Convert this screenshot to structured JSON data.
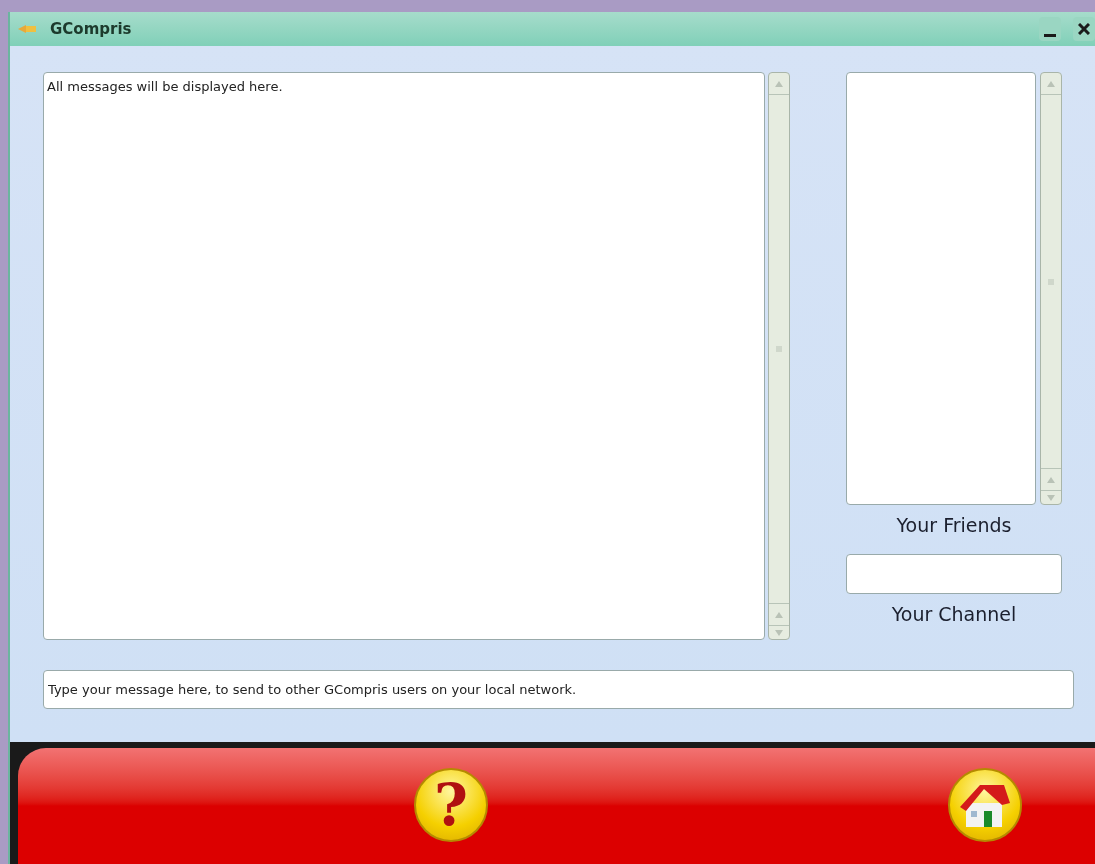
{
  "window": {
    "title": "GCompris"
  },
  "messages": {
    "value": "All messages will be displayed here."
  },
  "friends": {
    "label": "Your Friends"
  },
  "channel": {
    "label": "Your Channel"
  },
  "message_input": {
    "value": "Type your message here, to send to other GCompris users on your local network."
  },
  "help_button": {
    "label": "?"
  }
}
